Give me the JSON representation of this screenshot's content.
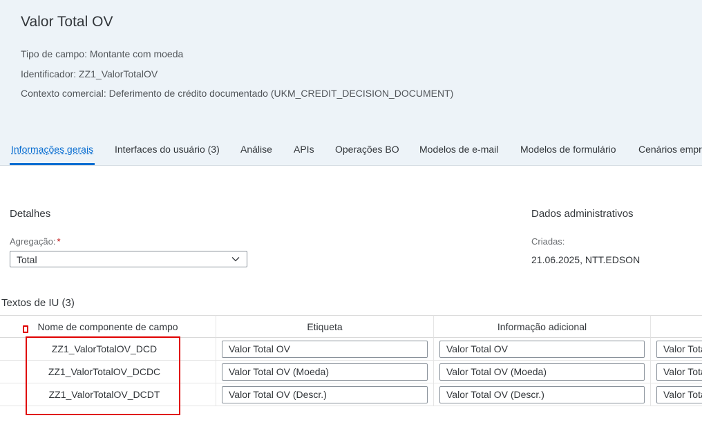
{
  "header": {
    "title": "Valor Total OV",
    "field_type": "Tipo de campo: Montante com moeda",
    "identifier": "Identificador: ZZ1_ValorTotalOV",
    "business_context": "Contexto comercial: Deferimento de crédito documentado (UKM_CREDIT_DECISION_DOCUMENT)"
  },
  "tabs": [
    {
      "label": "Informações gerais",
      "active": true
    },
    {
      "label": "Interfaces do usuário (3)"
    },
    {
      "label": "Análise"
    },
    {
      "label": "APIs"
    },
    {
      "label": "Operações BO"
    },
    {
      "label": "Modelos de e-mail"
    },
    {
      "label": "Modelos de formulário"
    },
    {
      "label": "Cenários empre"
    }
  ],
  "details": {
    "title": "Detalhes",
    "aggregation_label": "Agregação:",
    "required_marker": "*",
    "aggregation_value": "Total"
  },
  "admin": {
    "title": "Dados administrativos",
    "created_label": "Criadas:",
    "created_value": "21.06.2025, NTT.EDSON"
  },
  "ui_texts": {
    "title": "Textos de IU (3)",
    "columns": [
      "Nome de componente de campo",
      "Etiqueta",
      "Informação adicional"
    ],
    "rows": [
      {
        "component": "ZZ1_ValorTotalOV_DCD",
        "label": "Valor Total OV",
        "additional": "Valor Total OV",
        "extra": "Valor Tota"
      },
      {
        "component": "ZZ1_ValorTotalOV_DCDC",
        "label": "Valor Total OV (Moeda)",
        "additional": "Valor Total OV (Moeda)",
        "extra": "Valor Tota"
      },
      {
        "component": "ZZ1_ValorTotalOV_DCDT",
        "label": "Valor Total OV (Descr.)",
        "additional": "Valor Total OV (Descr.)",
        "extra": "Valor Tota"
      }
    ]
  },
  "colors": {
    "accent": "#0a6ed1",
    "annotation": "#e00000",
    "header_bg": "#edf3f8"
  },
  "icons": {
    "dropdown": "chevron-down-icon"
  }
}
